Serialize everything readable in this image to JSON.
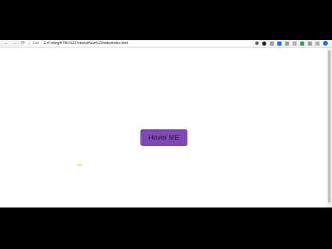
{
  "browser": {
    "nav": {
      "back": "←",
      "forward": "→",
      "reload": "⟳"
    },
    "omnibox": {
      "info_icon": "ⓘ",
      "scheme_label": "File",
      "url": "E:/Coding/HTML%20Tutorial/New%20folder/index.html"
    },
    "extensions": [
      "bookmark-star-icon",
      "extension-dark-icon",
      "extension-grey-icon",
      "extension-blue-icon",
      "extension-grey-icon",
      "extension-grey-icon",
      "extension-green-icon",
      "extension-grey-icon",
      "extension-grey-icon",
      "profile-avatar-icon"
    ]
  },
  "page": {
    "button_label": "Hover ME"
  },
  "colors": {
    "button_bg": "#7f47b8",
    "page_bg": "#ffffff",
    "frame_bg": "#000000"
  }
}
